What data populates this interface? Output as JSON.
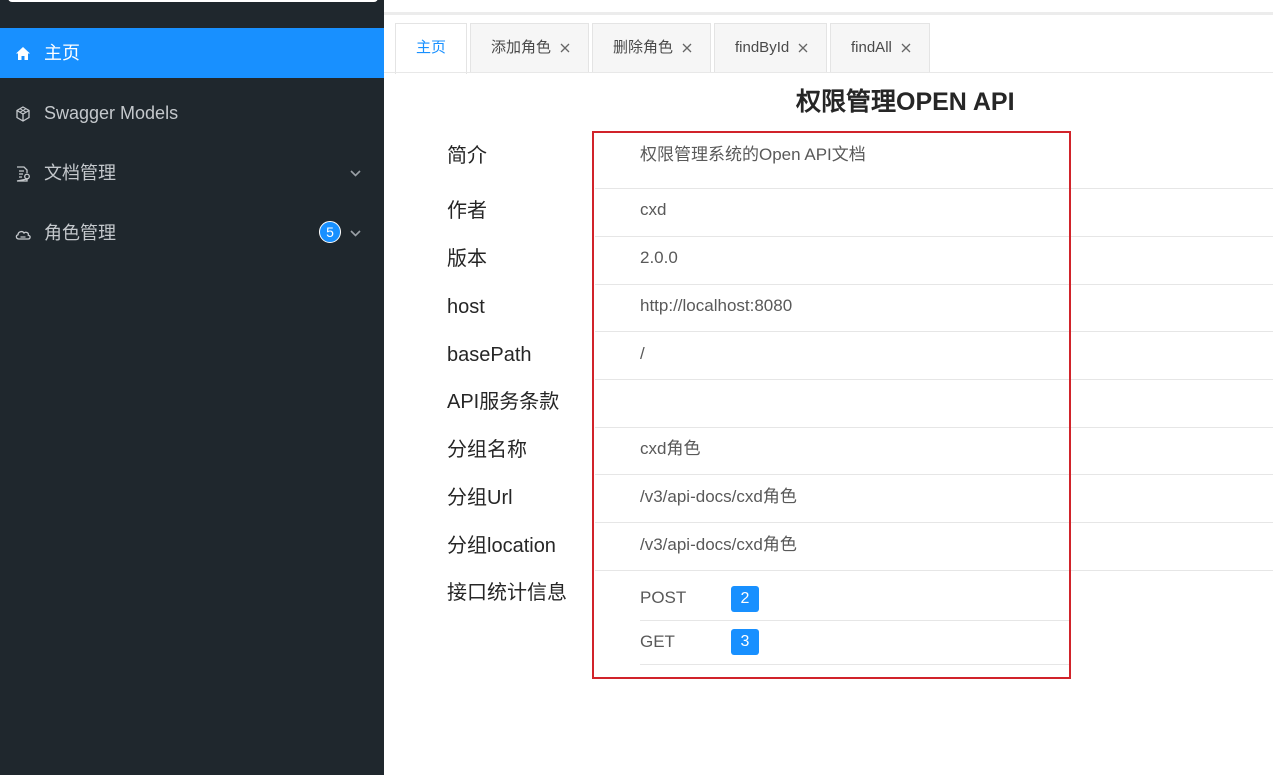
{
  "sidebar": {
    "items": [
      {
        "label": "主页",
        "icon": "home-icon",
        "active": true
      },
      {
        "label": "Swagger Models",
        "icon": "cube-icon",
        "active": false
      },
      {
        "label": "文档管理",
        "icon": "document-settings-icon",
        "active": false,
        "expandable": true
      },
      {
        "label": "角色管理",
        "icon": "cloud-icon",
        "active": false,
        "expandable": true,
        "badge": "5"
      }
    ]
  },
  "tabs": [
    {
      "label": "主页",
      "active": true,
      "closable": false
    },
    {
      "label": "添加角色",
      "active": false,
      "closable": true
    },
    {
      "label": "删除角色",
      "active": false,
      "closable": true
    },
    {
      "label": "findById",
      "active": false,
      "closable": true
    },
    {
      "label": "findAll",
      "active": false,
      "closable": true
    }
  ],
  "main": {
    "title": "权限管理OPEN API",
    "rows": [
      {
        "key": "简介",
        "value": "权限管理系统的Open API文档"
      },
      {
        "key": "作者",
        "value": "cxd"
      },
      {
        "key": "版本",
        "value": "2.0.0"
      },
      {
        "key": "host",
        "value": "http://localhost:8080"
      },
      {
        "key": "basePath",
        "value": "/"
      },
      {
        "key": "API服务条款",
        "value": ""
      },
      {
        "key": "分组名称",
        "value": "cxd角色"
      },
      {
        "key": "分组Url",
        "value": "/v3/api-docs/cxd角色"
      },
      {
        "key": "分组location",
        "value": "/v3/api-docs/cxd角色"
      }
    ],
    "stats": {
      "key": "接口统计信息",
      "items": [
        {
          "method": "POST",
          "count": "2"
        },
        {
          "method": "GET",
          "count": "3"
        }
      ]
    }
  },
  "colors": {
    "sidebar_bg": "#1f272d",
    "accent": "#1890ff",
    "highlight_border": "#d1232a"
  }
}
